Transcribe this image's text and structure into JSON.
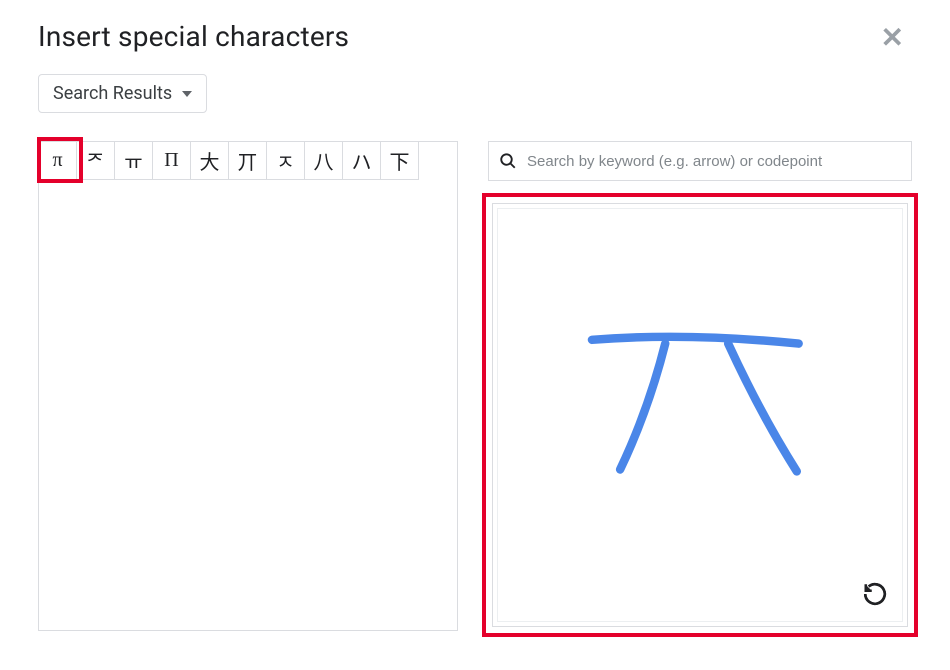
{
  "dialog": {
    "title": "Insert special characters"
  },
  "category": {
    "label": "Search Results"
  },
  "search": {
    "placeholder": "Search by keyword (e.g. arrow) or codepoint",
    "value": ""
  },
  "results": {
    "chars": [
      "π",
      "ᅎ",
      "ㅠ",
      "Π",
      "大",
      "丌",
      "ㅈ",
      "八",
      "ハ",
      "下"
    ]
  },
  "colors": {
    "highlight": "#e4002b",
    "stroke": "#4a86e8"
  }
}
